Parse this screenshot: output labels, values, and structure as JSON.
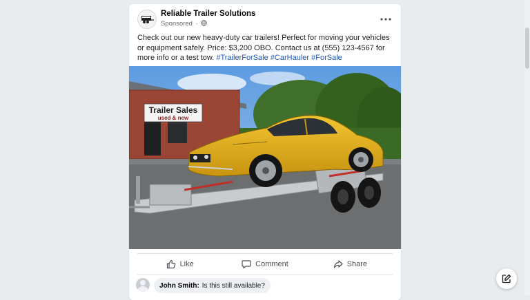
{
  "post": {
    "page_name": "Reliable Trailer Solutions",
    "sponsored": "Sponsored",
    "separator": "·",
    "more_icon": "more-horizontal-icon",
    "caption_text": "Check out our new heavy-duty car trailers! Perfect for moving your vehicles or equipment safely. Price: $3,200 OBO. Contact us at (555) 123-4567 for more info or a test tow.",
    "hashtags": [
      "#TrailerForSale",
      "#CarHauler",
      "#ForSale"
    ],
    "hashtag_color": "#1c56b8",
    "photo": {
      "sign_line1": "Trailer Sales",
      "sign_line2": "used & new"
    }
  },
  "actions": {
    "like": "Like",
    "comment": "Comment",
    "share": "Share"
  },
  "comment": {
    "author": "John Smith:",
    "text": "Is this still available?"
  },
  "fab": {
    "icon": "compose-icon"
  }
}
